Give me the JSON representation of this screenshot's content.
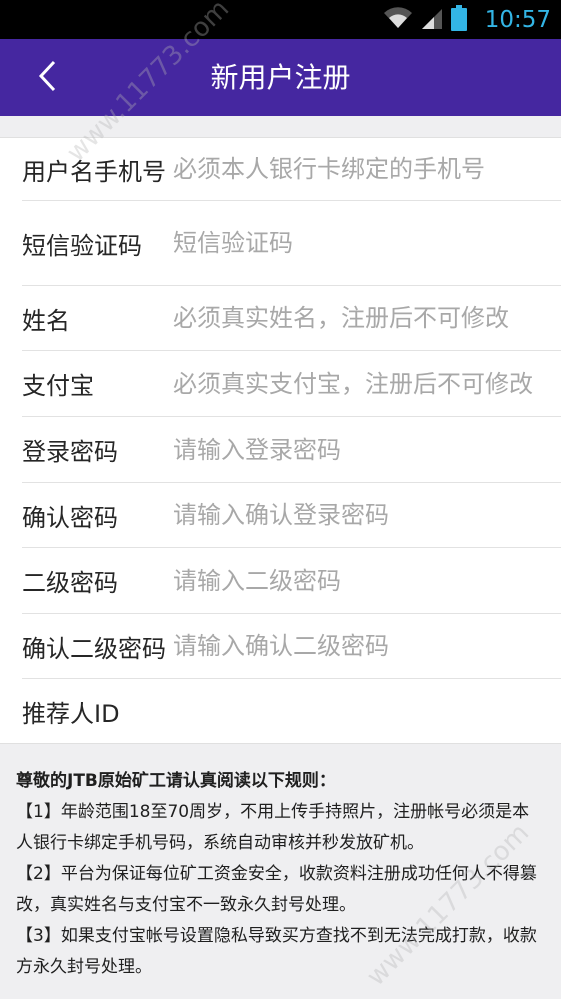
{
  "status_bar": {
    "time": "10:57",
    "icons": [
      "wifi-icon",
      "signal-icon",
      "battery-icon"
    ]
  },
  "header": {
    "title": "新用户注册",
    "back_icon": "chevron-left-icon"
  },
  "form": {
    "fields": [
      {
        "label": "用户名手机号",
        "placeholder": "必须本人银行卡绑定的手机号"
      },
      {
        "label": "短信验证码",
        "placeholder": "短信验证码"
      },
      {
        "label": "姓名",
        "placeholder": "必须真实姓名，注册后不可修改"
      },
      {
        "label": "支付宝",
        "placeholder": "必须真实支付宝，注册后不可修改"
      },
      {
        "label": "登录密码",
        "placeholder": "请输入登录密码"
      },
      {
        "label": "确认密码",
        "placeholder": "请输入确认登录密码"
      },
      {
        "label": "二级密码",
        "placeholder": "请输入二级密码"
      },
      {
        "label": "确认二级密码",
        "placeholder": "请输入确认二级密码"
      },
      {
        "label": "推荐人ID",
        "placeholder": ""
      }
    ]
  },
  "rules": {
    "title": "尊敬的JTB原始矿工请认真阅读以下规则：",
    "items": [
      "【1】年龄范围18至70周岁，不用上传手持照片，注册帐号必须是本人银行卡绑定手机号码，系统自动审核并秒发放矿机。",
      "【2】平台为保证每位矿工资金安全，收款资料注册成功任何人不得篡改，真实姓名与支付宝不一致永久封号处理。",
      "【3】如果支付宝帐号设置隐私导致买方查找不到无法完成打款，收款方永久封号处理。"
    ]
  },
  "watermark": "www.11773.com",
  "colors": {
    "app_bar": "#4527a0",
    "status_bar": "#000000",
    "status_time": "#33b5e5",
    "background": "#efeff1",
    "placeholder": "#a8a8a8"
  }
}
